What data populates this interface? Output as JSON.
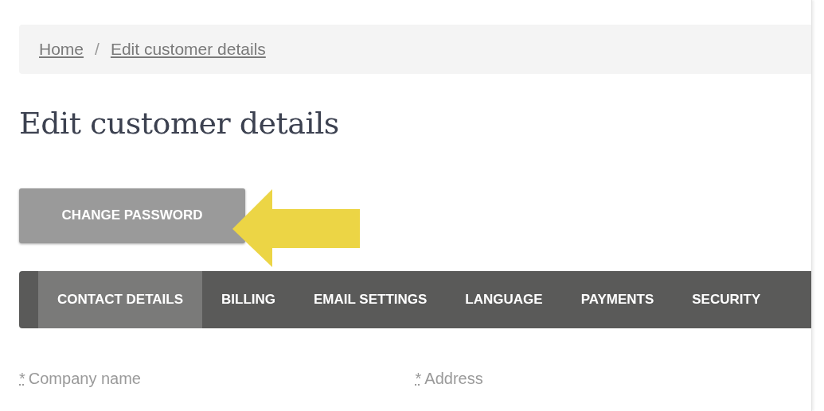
{
  "breadcrumb": [
    {
      "label": "Home"
    },
    {
      "label": "Edit customer details"
    }
  ],
  "breadcrumb_separator": "/",
  "heading": "Edit customer details",
  "change_password_button": "CHANGE PASSWORD",
  "tabs": [
    {
      "label": "CONTACT DETAILS",
      "selected": true
    },
    {
      "label": "BILLING",
      "selected": false
    },
    {
      "label": "EMAIL SETTINGS",
      "selected": false
    },
    {
      "label": "LANGUAGE",
      "selected": false
    },
    {
      "label": "PAYMENTS",
      "selected": false
    },
    {
      "label": "SECURITY",
      "selected": false
    }
  ],
  "fields": [
    {
      "required_mark": "*",
      "label": "Company name"
    },
    {
      "required_mark": "*",
      "label": "Address"
    }
  ]
}
